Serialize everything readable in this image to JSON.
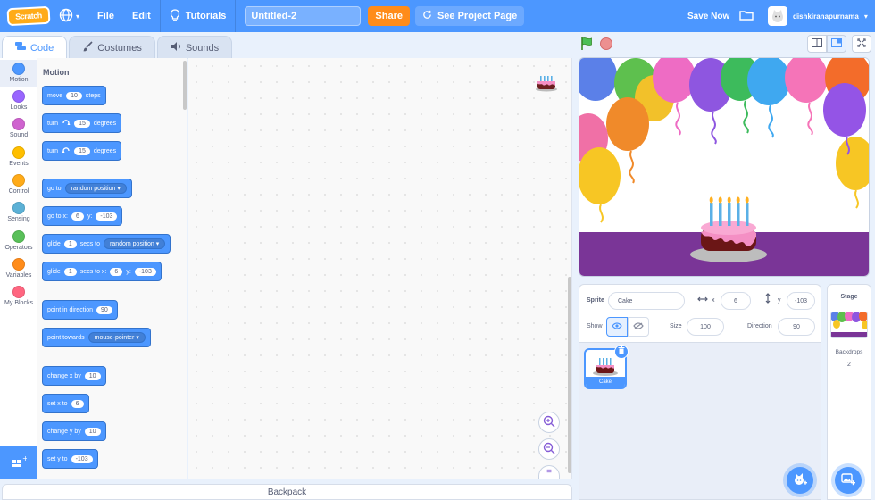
{
  "menubar": {
    "logo_text": "Scratch",
    "file": "File",
    "edit": "Edit",
    "tutorials": "Tutorials",
    "project_title": "Untitled-2",
    "share": "Share",
    "see_project_page": "See Project Page",
    "save_now": "Save Now",
    "username": "dishkiranapurnama"
  },
  "tabs": {
    "code": "Code",
    "costumes": "Costumes",
    "sounds": "Sounds"
  },
  "categories": [
    {
      "label": "Motion",
      "color": "#4c97ff"
    },
    {
      "label": "Looks",
      "color": "#9966ff"
    },
    {
      "label": "Sound",
      "color": "#cf63cf"
    },
    {
      "label": "Events",
      "color": "#ffbf00"
    },
    {
      "label": "Control",
      "color": "#ffab19"
    },
    {
      "label": "Sensing",
      "color": "#5cb1d6"
    },
    {
      "label": "Operators",
      "color": "#59c059"
    },
    {
      "label": "Variables",
      "color": "#ff8c1a"
    },
    {
      "label": "My Blocks",
      "color": "#ff6680"
    }
  ],
  "palette": {
    "title": "Motion",
    "blocks": {
      "move": {
        "text1": "move",
        "value": "10",
        "text2": "steps"
      },
      "turn_right": {
        "text1": "turn",
        "value": "15",
        "text2": "degrees"
      },
      "turn_left": {
        "text1": "turn",
        "value": "15",
        "text2": "degrees"
      },
      "goto": {
        "text1": "go to",
        "dropdown": "random position"
      },
      "gotoxy": {
        "text1": "go to x:",
        "x": "6",
        "text2": "y:",
        "y": "-103"
      },
      "glide_to": {
        "text1": "glide",
        "value": "1",
        "text2": "secs to",
        "dropdown": "random position"
      },
      "glide_xy": {
        "text1": "glide",
        "value": "1",
        "text2": "secs to x:",
        "x": "6",
        "text3": "y:",
        "y": "-103"
      },
      "point_dir": {
        "text1": "point in direction",
        "value": "90"
      },
      "point_towards": {
        "text1": "point towards",
        "dropdown": "mouse-pointer"
      },
      "change_x": {
        "text1": "change x by",
        "value": "10"
      },
      "set_x": {
        "text1": "set x to",
        "value": "6"
      },
      "change_y": {
        "text1": "change y by",
        "value": "10"
      },
      "set_y": {
        "text1": "set y to",
        "value": "-103"
      }
    }
  },
  "backpack": "Backpack",
  "sprite_info": {
    "sprite_label": "Sprite",
    "sprite_name": "Cake",
    "x_label": "x",
    "x": "6",
    "y_label": "y",
    "y": "-103",
    "show_label": "Show",
    "size_label": "Size",
    "size": "100",
    "direction_label": "Direction",
    "direction": "90"
  },
  "sprites": [
    {
      "name": "Cake"
    }
  ],
  "stage_panel": {
    "title": "Stage",
    "backdrops_label": "Backdrops",
    "backdrops_count": "2"
  },
  "colors": {
    "accent": "#4c97ff",
    "share": "#ff8c1a",
    "stage_floor": "#7a3597"
  }
}
